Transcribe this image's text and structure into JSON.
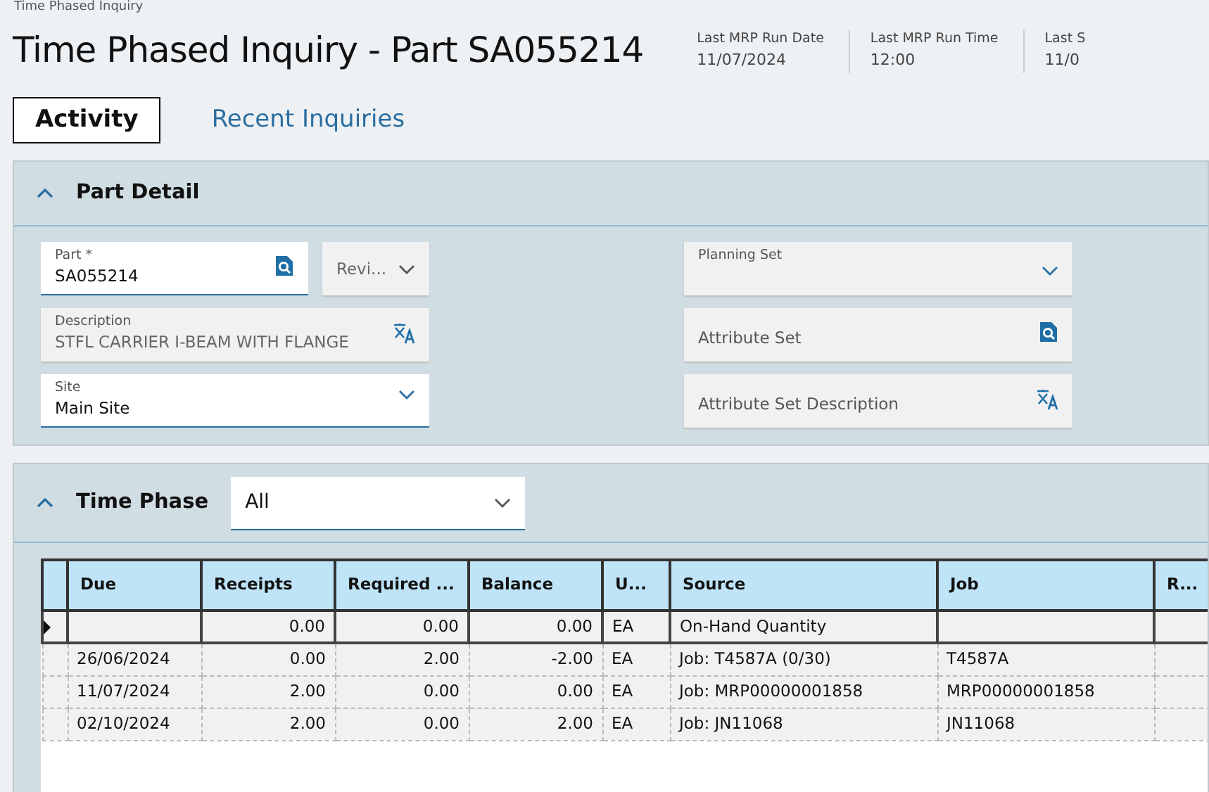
{
  "breadcrumb": "Time Phased Inquiry",
  "title": "Time Phased Inquiry - Part SA055214",
  "header_stats": [
    {
      "label": "Last MRP Run Date",
      "value": "11/07/2024"
    },
    {
      "label": "Last MRP Run Time",
      "value": "12:00"
    },
    {
      "label": "Last S",
      "value": "11/0"
    }
  ],
  "tabs": [
    {
      "label": "Activity",
      "selected": true
    },
    {
      "label": "Recent Inquiries",
      "selected": false
    }
  ],
  "part_detail": {
    "title": "Part Detail",
    "expanded": true,
    "left_fields": [
      {
        "kind": "lookup",
        "label": "Part *",
        "value": "SA055214",
        "editable": true
      },
      {
        "kind": "translate",
        "label": "Description",
        "value": "STFL CARRIER I-BEAM WITH FLANGE",
        "editable": false
      },
      {
        "kind": "select",
        "label": "Site",
        "value": "Main Site",
        "editable": true
      }
    ],
    "revision": {
      "label": "Revi..."
    },
    "right_fields": [
      {
        "kind": "select",
        "label": "Planning Set",
        "editable": false
      },
      {
        "kind": "lookup",
        "label": "Attribute Set",
        "editable": false
      },
      {
        "kind": "translate",
        "label": "Attribute Set Description",
        "editable": false
      }
    ]
  },
  "time_phase": {
    "title": "Time Phase",
    "expanded": true,
    "filter": "All",
    "table": {
      "columns": [
        "Due",
        "Receipts",
        "Required ...",
        "Balance",
        "U...",
        "Source",
        "Job",
        "R..."
      ],
      "rows": [
        {
          "selected": true,
          "cells": [
            "",
            "0.00",
            "0.00",
            "0.00",
            "EA",
            "On-Hand Quantity",
            "",
            ""
          ]
        },
        {
          "selected": false,
          "cells": [
            "26/06/2024",
            "0.00",
            "2.00",
            "-2.00",
            "EA",
            "Job: T4587A (0/30)",
            "T4587A",
            ""
          ]
        },
        {
          "selected": false,
          "cells": [
            "11/07/2024",
            "2.00",
            "0.00",
            "0.00",
            "EA",
            "Job: MRP00000001858",
            "MRP00000001858",
            ""
          ]
        },
        {
          "selected": false,
          "cells": [
            "02/10/2024",
            "2.00",
            "0.00",
            "2.00",
            "EA",
            "Job: JN11068",
            "JN11068",
            ""
          ]
        }
      ]
    }
  }
}
